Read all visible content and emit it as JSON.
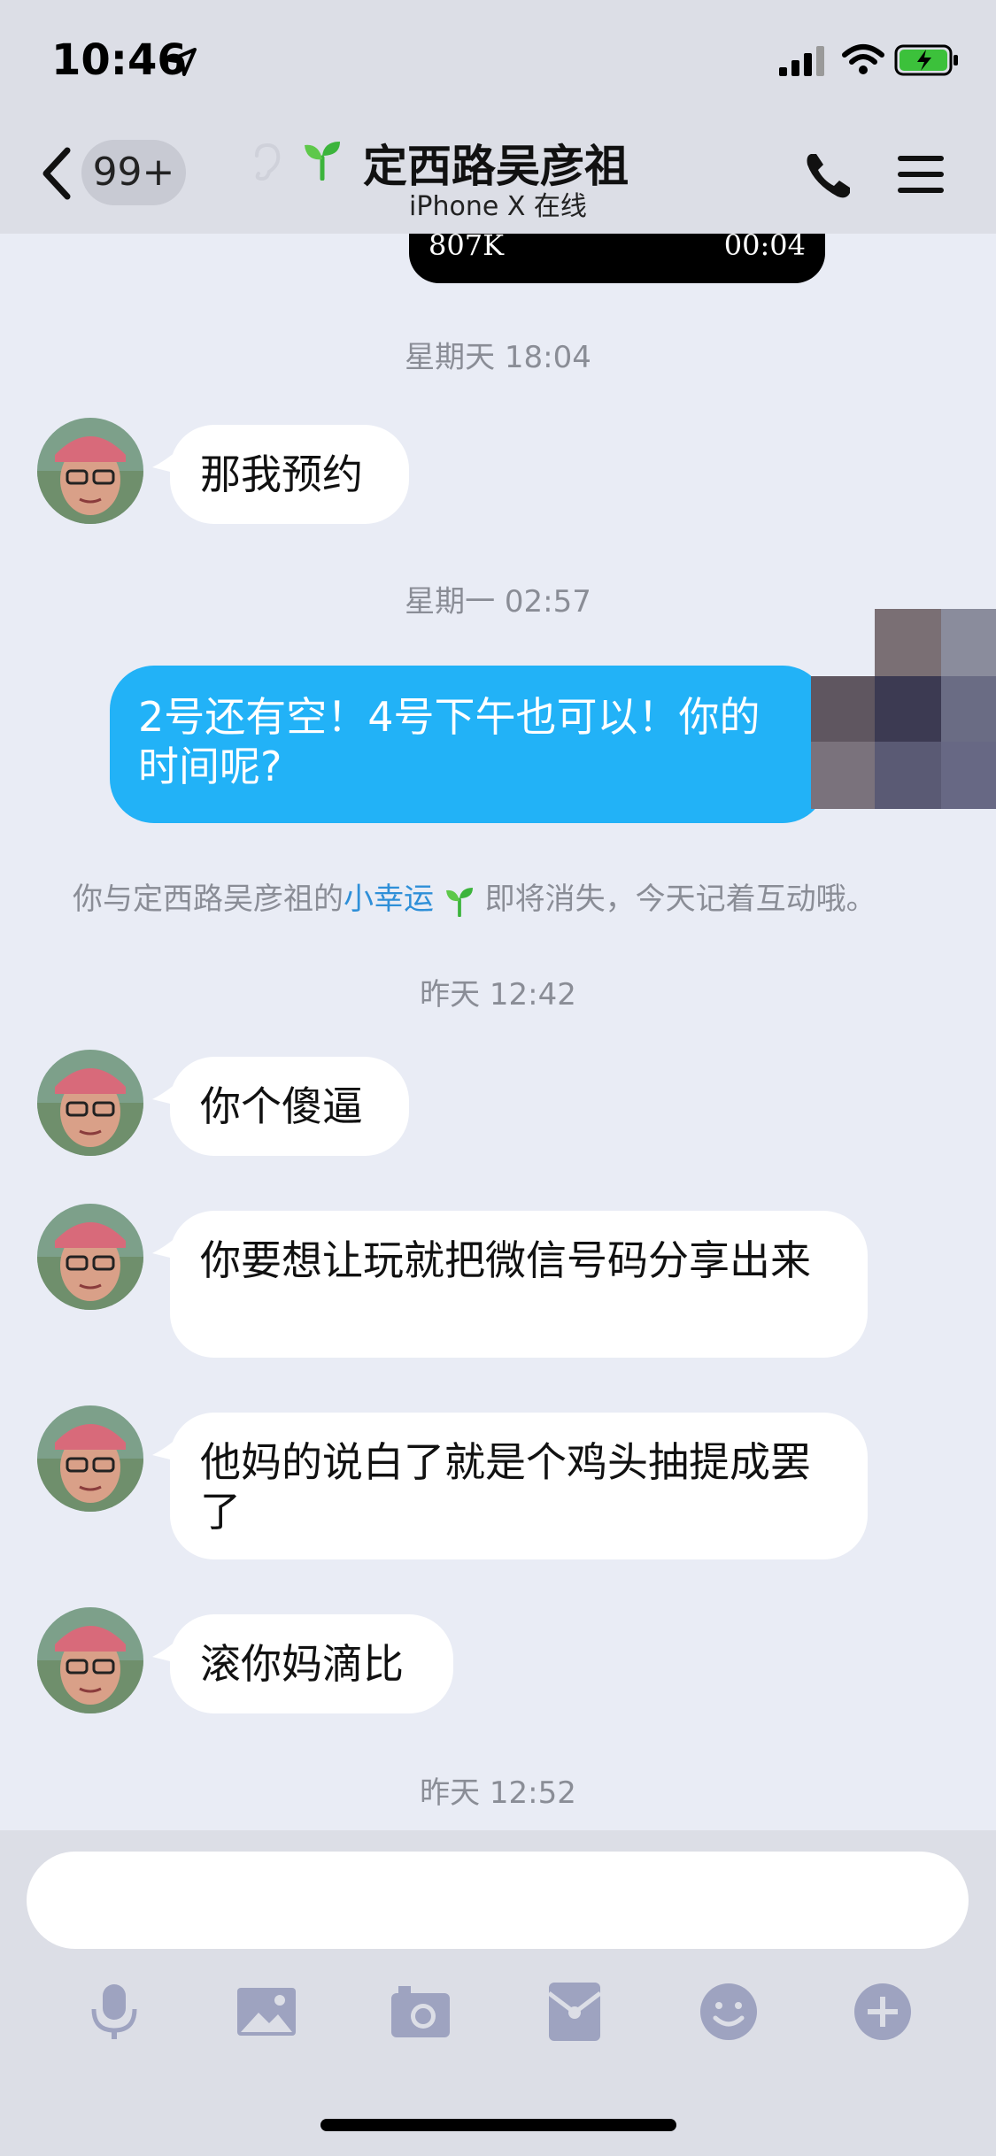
{
  "status_bar": {
    "time": "10:46"
  },
  "nav": {
    "unread_count": "99+",
    "contact_name": "定西路吴彦祖",
    "device_status": "iPhone X 在线"
  },
  "messages": {
    "voice": {
      "size": "807K",
      "duration": "00:04"
    },
    "ts1": "星期天 18:04",
    "m1": "那我预约",
    "ts2": "星期一 02:57",
    "m2": "2号还有空！4号下午也可以！你的时间呢?",
    "system_prefix": "你与定西路吴彦祖的",
    "system_link": "小幸运",
    "system_suffix": "即将消失，今天记着互动哦。",
    "ts3": "昨天 12:42",
    "m3": "你个傻逼",
    "m4": "你要想让玩就把微信号码分享出来",
    "m5": "他妈的说白了就是个鸡头抽提成罢了",
    "m6": "滚你妈滴比",
    "ts4": "昨天 12:52"
  },
  "input": {
    "placeholder": ""
  },
  "colors": {
    "my_bubble": "#22b2f7",
    "link": "#2e8fd8",
    "icon": "#9ea3c0"
  }
}
